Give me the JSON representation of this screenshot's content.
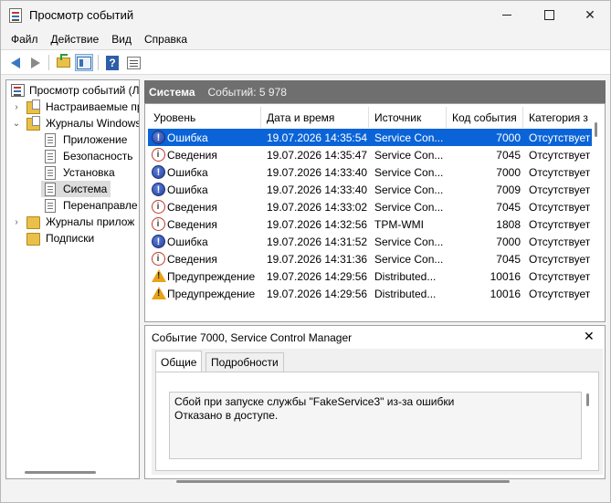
{
  "window": {
    "title": "Просмотр событий"
  },
  "menu": [
    {
      "label": "Файл"
    },
    {
      "label": "Действие"
    },
    {
      "label": "Вид"
    },
    {
      "label": "Справка"
    }
  ],
  "tree": {
    "items": [
      {
        "label": "Просмотр событий (Л",
        "icon": "event-viewer-icon"
      },
      {
        "label": "Настраиваемые пр",
        "icon": "folder-icon"
      },
      {
        "label": "Журналы Windows",
        "icon": "folder-icon"
      },
      {
        "label": "Приложение",
        "icon": "log-icon"
      },
      {
        "label": "Безопасность",
        "icon": "log-icon"
      },
      {
        "label": "Установка",
        "icon": "log-icon"
      },
      {
        "label": "Система",
        "icon": "log-icon"
      },
      {
        "label": "Перенаправле",
        "icon": "log-icon"
      },
      {
        "label": "Журналы прилож",
        "icon": "folder-icon"
      },
      {
        "label": "Подписки",
        "icon": "folder-icon"
      }
    ]
  },
  "log": {
    "name": "Система",
    "count_label": "Событий: 5 978"
  },
  "table": {
    "columns": [
      "Уровень",
      "Дата и время",
      "Источник",
      "Код события",
      "Категория з"
    ],
    "rows": [
      {
        "level": "Ошибка",
        "icon": "error",
        "date": "19.07.2026 14:35:54",
        "source": "Service Con...",
        "id": "7000",
        "category": "Отсутствует"
      },
      {
        "level": "Сведения",
        "icon": "info",
        "date": "19.07.2026 14:35:47",
        "source": "Service Con...",
        "id": "7045",
        "category": "Отсутствует"
      },
      {
        "level": "Ошибка",
        "icon": "error",
        "date": "19.07.2026 14:33:40",
        "source": "Service Con...",
        "id": "7000",
        "category": "Отсутствует"
      },
      {
        "level": "Ошибка",
        "icon": "error",
        "date": "19.07.2026 14:33:40",
        "source": "Service Con...",
        "id": "7009",
        "category": "Отсутствует"
      },
      {
        "level": "Сведения",
        "icon": "info",
        "date": "19.07.2026 14:33:02",
        "source": "Service Con...",
        "id": "7045",
        "category": "Отсутствует"
      },
      {
        "level": "Сведения",
        "icon": "info",
        "date": "19.07.2026 14:32:56",
        "source": "TPM-WMI",
        "id": "1808",
        "category": "Отсутствует"
      },
      {
        "level": "Ошибка",
        "icon": "error",
        "date": "19.07.2026 14:31:52",
        "source": "Service Con...",
        "id": "7000",
        "category": "Отсутствует"
      },
      {
        "level": "Сведения",
        "icon": "info",
        "date": "19.07.2026 14:31:36",
        "source": "Service Con...",
        "id": "7045",
        "category": "Отсутствует"
      },
      {
        "level": "Предупреждение",
        "icon": "warning",
        "date": "19.07.2026 14:29:56",
        "source": "Distributed...",
        "id": "10016",
        "category": "Отсутствует"
      },
      {
        "level": "Предупреждение",
        "icon": "warning",
        "date": "19.07.2026 14:29:56",
        "source": "Distributed...",
        "id": "10016",
        "category": "Отсутствует"
      }
    ]
  },
  "detail": {
    "title": "Событие 7000, Service Control Manager",
    "tabs": [
      "Общие",
      "Подробности"
    ],
    "description_line1": "Сбой при запуске службы \"FakeService3\" из-за ошибки",
    "description_line2": "Отказано в доступе."
  },
  "colors": {
    "selection": "#0a64d8",
    "header_bar": "#6f6f6f"
  }
}
